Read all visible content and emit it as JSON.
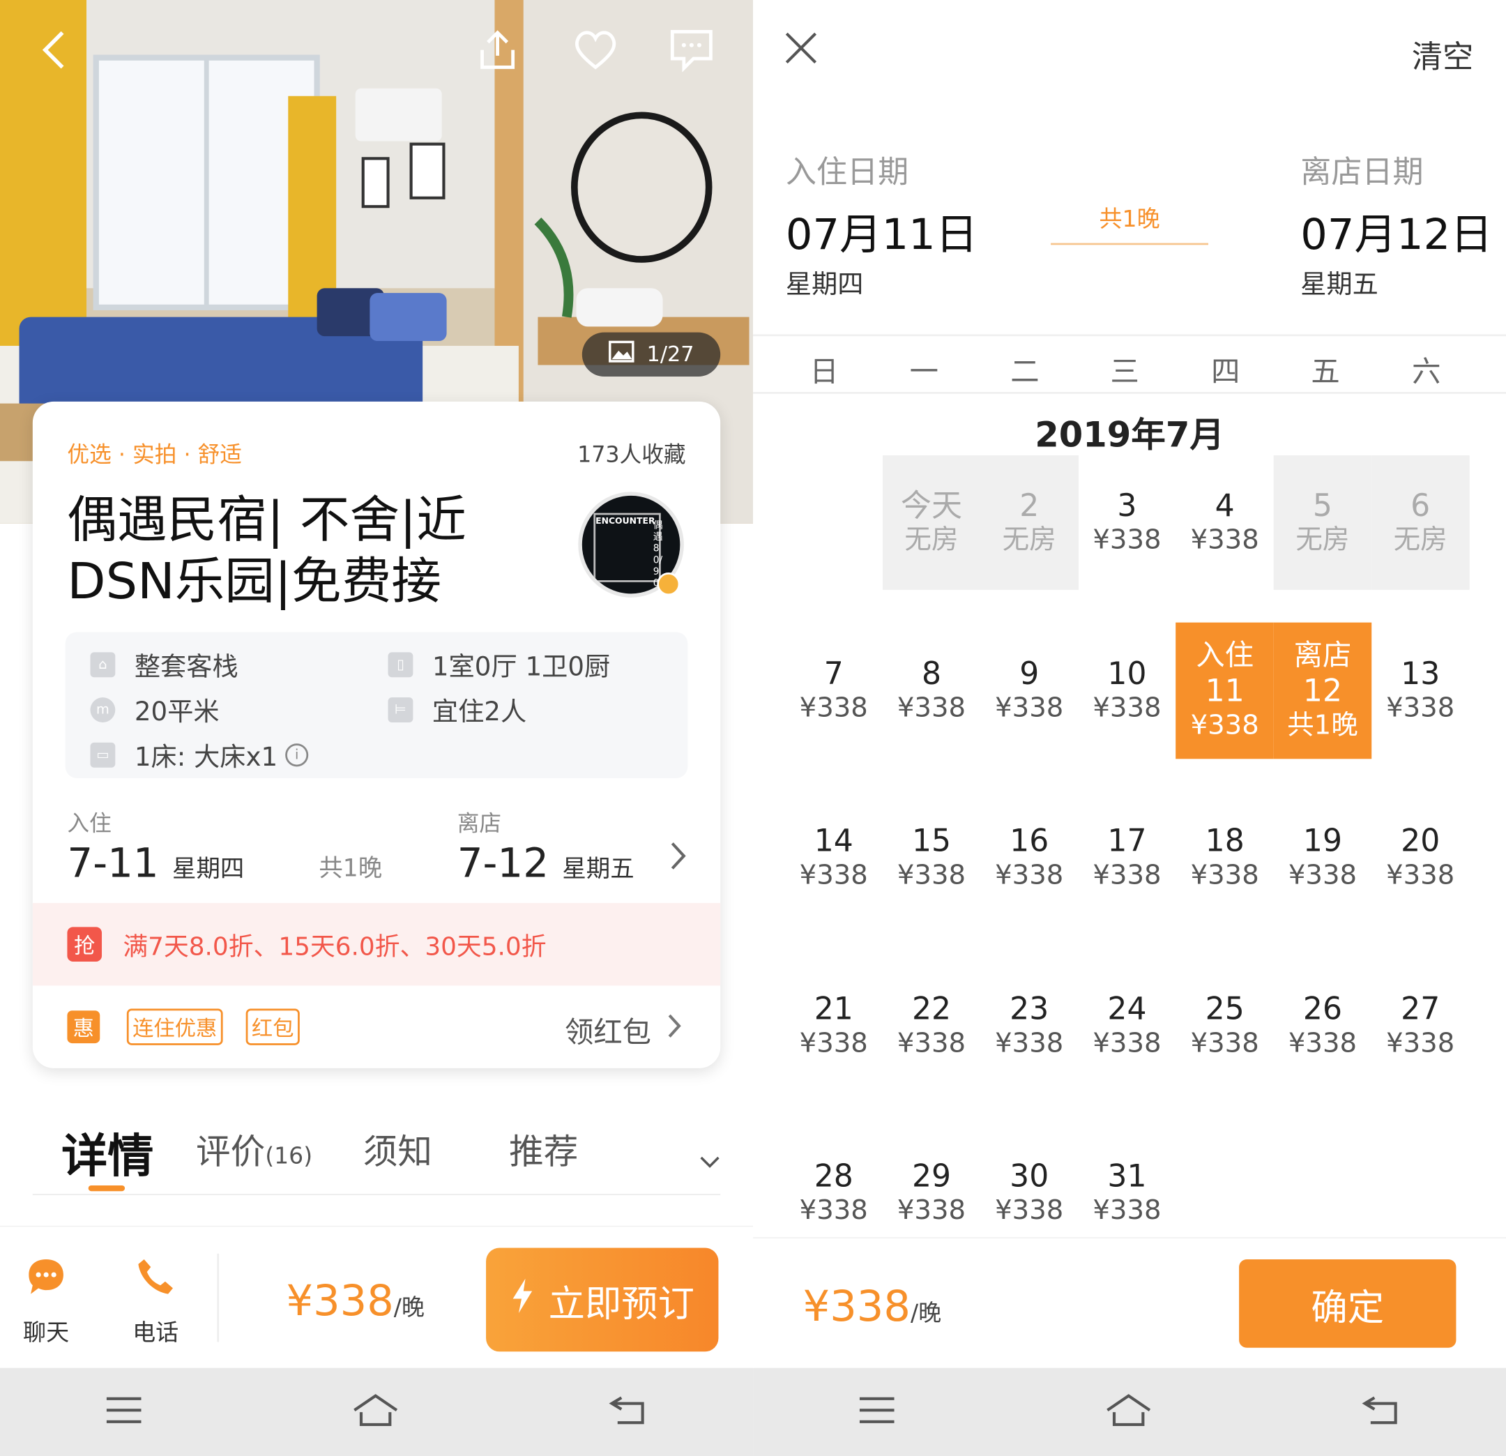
{
  "photo": {
    "counter": "1/27"
  },
  "listing": {
    "tags": "优选 · 实拍 · 舒适",
    "favorites": "173人收藏",
    "title": "偶遇民宿| 不舍|近DSN乐园|免费接",
    "avatar_text": "ENCOUNTER",
    "avatar_side": "偶遇 80/90",
    "facts": {
      "type": "整套客栈",
      "layout": "1室0厅 1卫0厨",
      "area": "20平米",
      "guests": "宜住2人",
      "beds": "1床: 大床x1"
    },
    "checkin": {
      "label": "入住",
      "date": "7-11",
      "weekday": "星期四"
    },
    "nights": "共1晚",
    "checkout": {
      "label": "离店",
      "date": "7-12",
      "weekday": "星期五"
    },
    "promo": {
      "badge": "抢",
      "text": "满7天8.0折、15天6.0折、30天5.0折"
    },
    "offers": {
      "badge": "惠",
      "tag1": "连住优惠",
      "tag2": "红包",
      "action": "领红包"
    }
  },
  "tabs": [
    {
      "label": "详情"
    },
    {
      "label": "评价",
      "count": "(16)"
    },
    {
      "label": "须知"
    },
    {
      "label": "推荐"
    }
  ],
  "bottom_bar": {
    "chat": "聊天",
    "phone": "电话",
    "price": "¥338",
    "unit": "/晚",
    "book": "立即预订"
  },
  "calendar": {
    "clear": "清空",
    "checkin_label": "入住日期",
    "checkin_date": "07月11日",
    "checkin_weekday": "星期四",
    "nights": "共1晚",
    "checkout_label": "离店日期",
    "checkout_date": "07月12日",
    "checkout_weekday": "星期五",
    "weekdays": [
      "日",
      "一",
      "二",
      "三",
      "四",
      "五",
      "六"
    ],
    "month": "2019年7月",
    "days": [
      {
        "col": 1,
        "row": 0,
        "day": "今天",
        "price": "无房",
        "status": "unavailable"
      },
      {
        "col": 2,
        "row": 0,
        "day": "2",
        "price": "无房",
        "status": "unavailable"
      },
      {
        "col": 3,
        "row": 0,
        "day": "3",
        "price": "¥338"
      },
      {
        "col": 4,
        "row": 0,
        "day": "4",
        "price": "¥338"
      },
      {
        "col": 5,
        "row": 0,
        "day": "5",
        "price": "无房",
        "status": "unavailable"
      },
      {
        "col": 6,
        "row": 0,
        "day": "6",
        "price": "无房",
        "status": "unavailable"
      },
      {
        "col": 0,
        "row": 1,
        "day": "7",
        "price": "¥338"
      },
      {
        "col": 1,
        "row": 1,
        "day": "8",
        "price": "¥338"
      },
      {
        "col": 2,
        "row": 1,
        "day": "9",
        "price": "¥338"
      },
      {
        "col": 3,
        "row": 1,
        "day": "10",
        "price": "¥338"
      },
      {
        "col": 4,
        "row": 1,
        "day": "11",
        "price": "¥338",
        "top": "入住",
        "status": "selected"
      },
      {
        "col": 5,
        "row": 1,
        "day": "12",
        "price": "共1晚",
        "top": "离店",
        "status": "selected"
      },
      {
        "col": 6,
        "row": 1,
        "day": "13",
        "price": "¥338"
      },
      {
        "col": 0,
        "row": 2,
        "day": "14",
        "price": "¥338"
      },
      {
        "col": 1,
        "row": 2,
        "day": "15",
        "price": "¥338"
      },
      {
        "col": 2,
        "row": 2,
        "day": "16",
        "price": "¥338"
      },
      {
        "col": 3,
        "row": 2,
        "day": "17",
        "price": "¥338"
      },
      {
        "col": 4,
        "row": 2,
        "day": "18",
        "price": "¥338"
      },
      {
        "col": 5,
        "row": 2,
        "day": "19",
        "price": "¥338"
      },
      {
        "col": 6,
        "row": 2,
        "day": "20",
        "price": "¥338"
      },
      {
        "col": 0,
        "row": 3,
        "day": "21",
        "price": "¥338"
      },
      {
        "col": 1,
        "row": 3,
        "day": "22",
        "price": "¥338"
      },
      {
        "col": 2,
        "row": 3,
        "day": "23",
        "price": "¥338"
      },
      {
        "col": 3,
        "row": 3,
        "day": "24",
        "price": "¥338"
      },
      {
        "col": 4,
        "row": 3,
        "day": "25",
        "price": "¥338"
      },
      {
        "col": 5,
        "row": 3,
        "day": "26",
        "price": "¥338"
      },
      {
        "col": 6,
        "row": 3,
        "day": "27",
        "price": "¥338"
      },
      {
        "col": 0,
        "row": 4,
        "day": "28",
        "price": "¥338"
      },
      {
        "col": 1,
        "row": 4,
        "day": "29",
        "price": "¥338"
      },
      {
        "col": 2,
        "row": 4,
        "day": "30",
        "price": "¥338"
      },
      {
        "col": 3,
        "row": 4,
        "day": "31",
        "price": "¥338"
      }
    ],
    "price": "¥338",
    "unit": "/晚",
    "confirm": "确定"
  },
  "colors": {
    "accent": "#f7902a",
    "promo_red": "#f2574a",
    "promo_bg": "#fdf0ef",
    "unavailable_bg": "#f0f0f0"
  },
  "icons": [
    "back-arrow-icon",
    "share-icon",
    "heart-icon",
    "message-icon",
    "image-icon",
    "chat-bubble-icon",
    "phone-icon",
    "lightning-icon",
    "close-icon",
    "info-icon",
    "chevron-right-icon",
    "chevron-down-icon",
    "menu-icon",
    "home-icon",
    "return-icon"
  ]
}
